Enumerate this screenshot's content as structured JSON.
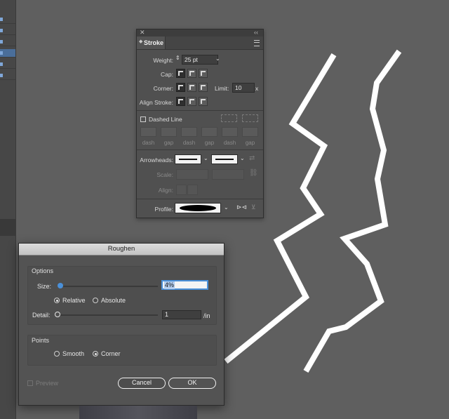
{
  "stroke_panel": {
    "close_glyph": "✕",
    "collapse_glyph": "‹‹",
    "tab_label": "Stroke",
    "weight": {
      "label": "Weight:",
      "value": "25 pt"
    },
    "cap_label": "Cap:",
    "corner_label": "Corner:",
    "limit": {
      "label": "Limit:",
      "value": "10",
      "unit": "x"
    },
    "align_stroke_label": "Align Stroke:",
    "dashed_line_label": "Dashed Line",
    "dash_labels": [
      "dash",
      "gap",
      "dash",
      "gap",
      "dash",
      "gap"
    ],
    "arrowheads_label": "Arrowheads:",
    "scale_label": "Scale:",
    "align_label": "Align:",
    "profile_label": "Profile:"
  },
  "roughen": {
    "title": "Roughen",
    "options_label": "Options",
    "size": {
      "label": "Size:",
      "value": "4%"
    },
    "relative_label": "Relative",
    "absolute_label": "Absolute",
    "detail": {
      "label": "Detail:",
      "value": "1",
      "unit": "/in"
    },
    "points_label": "Points",
    "smooth_label": "Smooth",
    "corner_label": "Corner",
    "preview_label": "Preview",
    "cancel_label": "Cancel",
    "ok_label": "OK",
    "selected_scale": "relative",
    "selected_points": "corner"
  },
  "colors": {
    "canvas": "#5f5f5f",
    "panel": "#505050",
    "accent": "#4a90d9",
    "stroke": "#ffffff"
  }
}
